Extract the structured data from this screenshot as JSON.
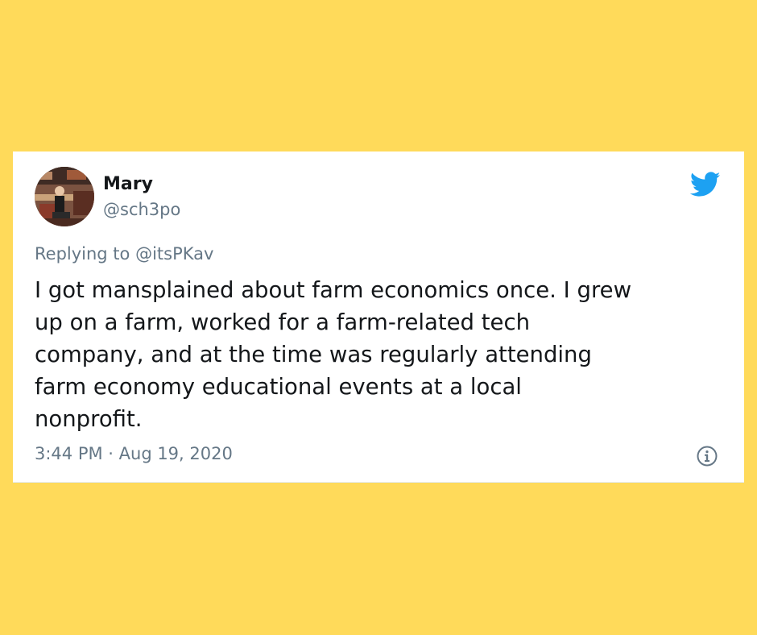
{
  "background_color": "#FFDA5A",
  "tweet": {
    "author": {
      "display_name": "Mary",
      "handle": "@sch3po",
      "avatar_icon": "profile-photo"
    },
    "brand_icon": "twitter-bird-icon",
    "brand_color": "#1DA1F2",
    "reply": {
      "prefix": "Replying to",
      "mention": "@itsPKav"
    },
    "text_lines": [
      "I got mansplained about farm economics once. I grew",
      "up on a farm, worked for a farm-related tech",
      "company, and at the time was regularly attending",
      "farm economy educational events at a local",
      "nonprofit."
    ],
    "timestamp": "3:44 PM · Aug 19, 2020",
    "info_icon": "info-icon"
  }
}
